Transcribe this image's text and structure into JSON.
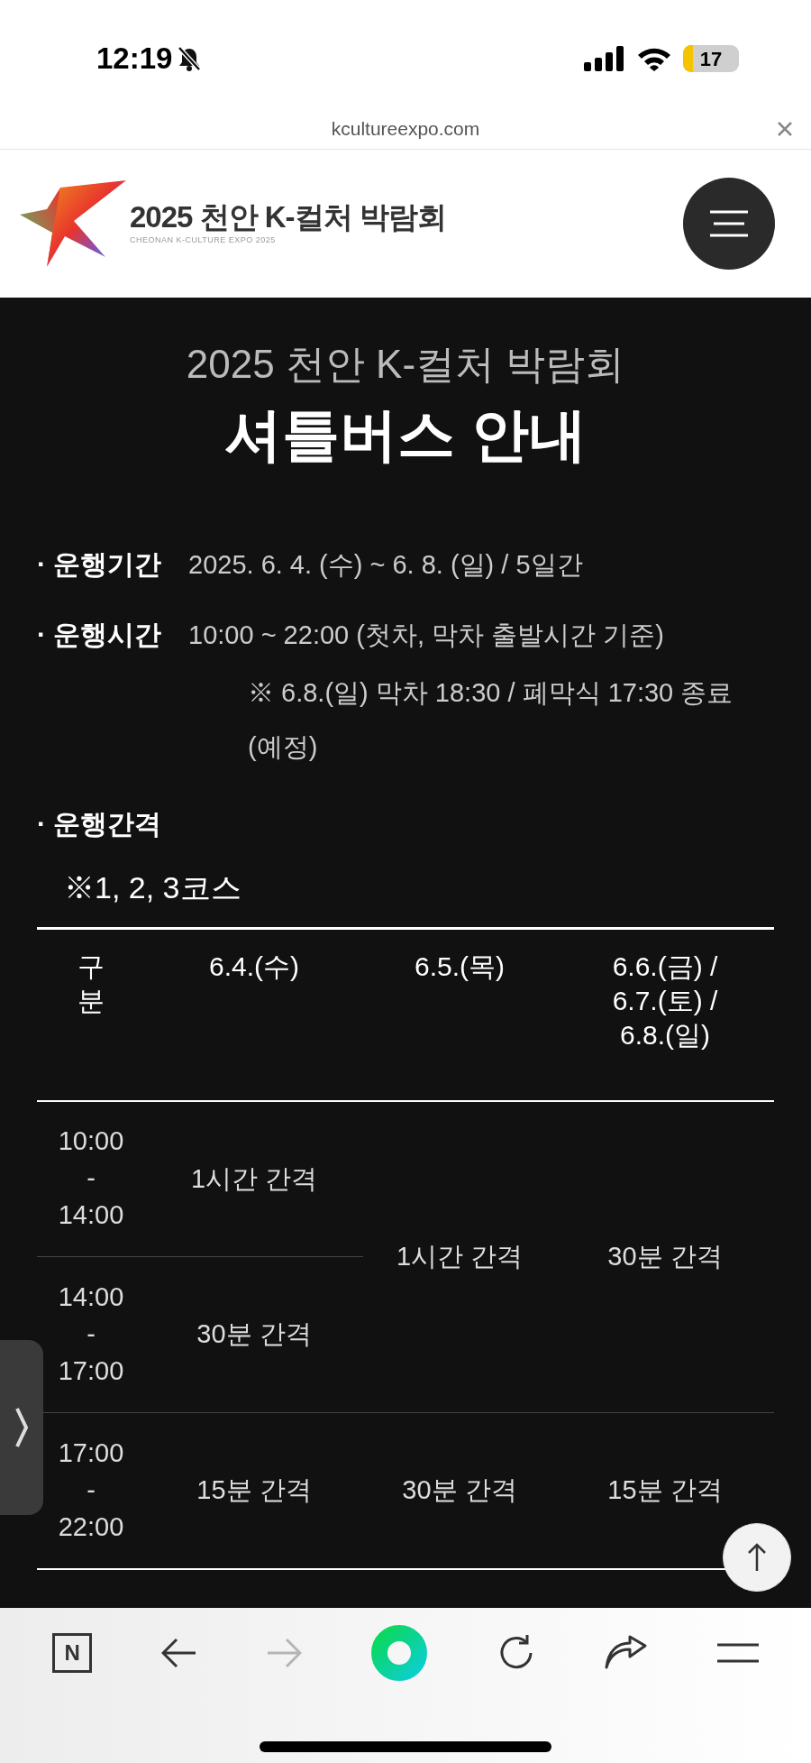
{
  "status_bar": {
    "time": "12:19",
    "battery": "17"
  },
  "browser": {
    "url": "kcultureexpo.com"
  },
  "header": {
    "logo_title": "2025 천안 K-컬처 박람회",
    "logo_subtitle": "CHEONAN K-CULTURE EXPO 2025"
  },
  "page": {
    "title": "2025 천안 K-컬처 박람회",
    "heading": "셔틀버스 안내",
    "info": [
      {
        "label": "· 운행기간",
        "value": "2025. 6. 4. (수) ~ 6. 8. (일) / 5일간"
      },
      {
        "label": "· 운행시간",
        "value": "10:00 ~ 22:00 (첫차, 막차 출발시간 기준)",
        "note": "※ 6.8.(일) 막차 18:30 / 폐막식 17:30 종료 (예정)"
      },
      {
        "label": "· 운행간격"
      }
    ],
    "course_note": "※1, 2, 3코스",
    "table": {
      "columns": [
        "구분",
        "6.4.(수)",
        "6.5.(목)",
        "6.6.(금) / 6.7.(토) / 6.8.(일)"
      ],
      "rows": [
        [
          {
            "text": "10:00 - 14:00",
            "kind": "time"
          },
          {
            "text": "1시간 간격"
          },
          {
            "text": "1시간 간격",
            "rowspan": 2
          },
          {
            "text": "30분 간격",
            "rowspan": 2
          }
        ],
        [
          {
            "text": "14:00 - 17:00",
            "kind": "time"
          },
          {
            "text": "30분 간격"
          }
        ],
        [
          {
            "text": "17:00 - 22:00",
            "kind": "time"
          },
          {
            "text": "15분 간격"
          },
          {
            "text": "30분 간격"
          },
          {
            "text": "15분 간격"
          }
        ]
      ]
    }
  },
  "toolbar": {
    "logo_letter": "N",
    "forward_disabled": true
  }
}
